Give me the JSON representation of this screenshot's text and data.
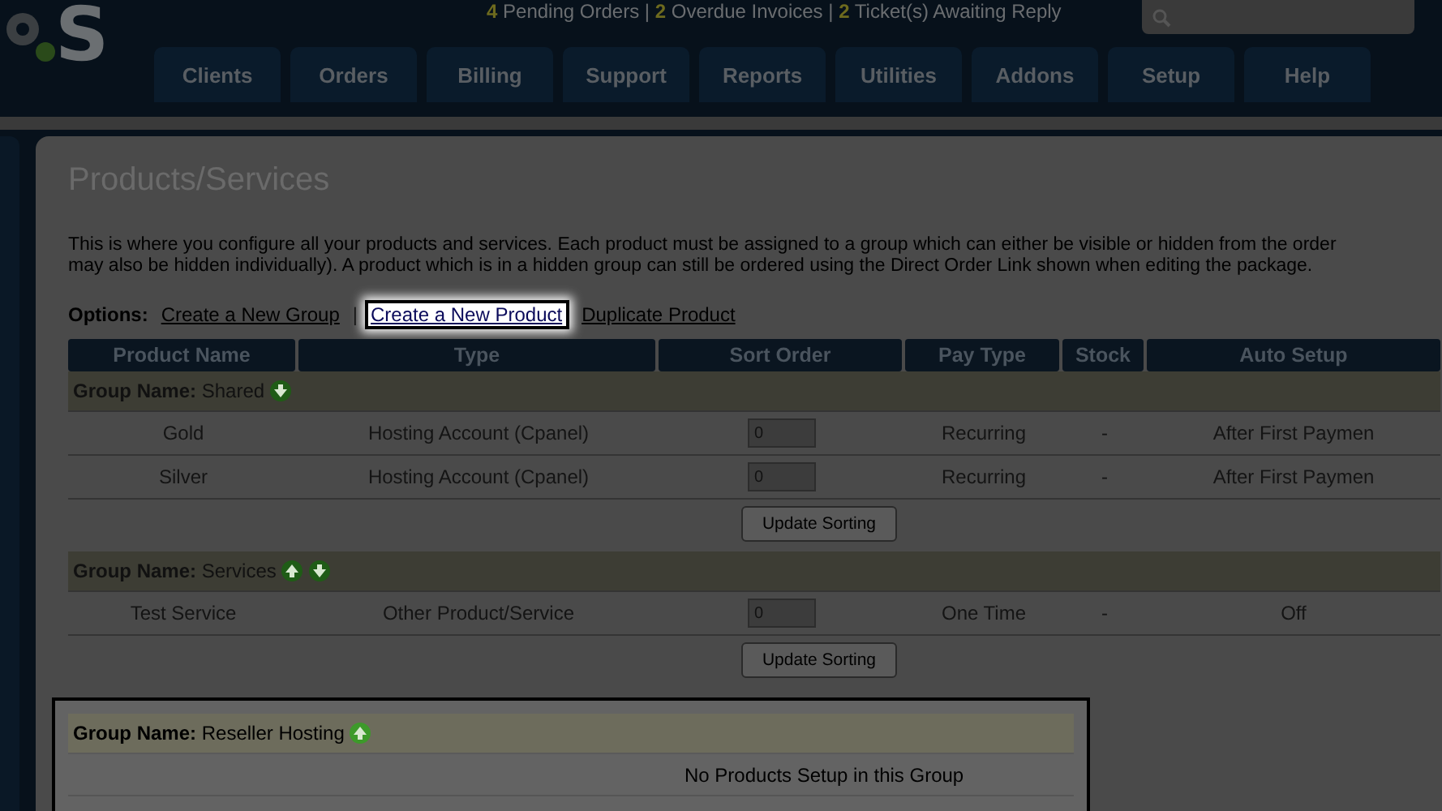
{
  "header": {
    "logo": {
      "text": "S"
    },
    "alerts": [
      {
        "count": "4",
        "label": "Pending Orders"
      },
      {
        "count": "2",
        "label": "Overdue Invoices"
      },
      {
        "count": "2",
        "label": "Ticket(s) Awaiting Reply"
      }
    ],
    "alert_separator": "|"
  },
  "nav": [
    "Clients",
    "Orders",
    "Billing",
    "Support",
    "Reports",
    "Utilities",
    "Addons",
    "Setup",
    "Help"
  ],
  "page": {
    "title": "Products/Services",
    "intro": [
      "This is where you configure all your products and services. Each product must be assigned to a group which can either be visible or hidden from the order",
      "may also be hidden individually). A product which is in a hidden group can still be ordered using the Direct Order Link shown when editing the package."
    ],
    "options": {
      "label": "Options:",
      "items": [
        {
          "kind": "link",
          "text": "Create a New Group",
          "highlighted": false
        },
        {
          "kind": "separator",
          "text": "|"
        },
        {
          "kind": "link",
          "text": "Create a New Product",
          "highlighted": true
        },
        {
          "kind": "link",
          "text": "Duplicate Product",
          "highlighted": false
        }
      ]
    }
  },
  "table": {
    "columns": [
      "Product Name",
      "Type",
      "Sort Order",
      "Pay Type",
      "Stock",
      "Auto Setup"
    ],
    "groups": [
      {
        "label": "Group Name:",
        "name": "Shared",
        "highlighted": false,
        "sort_buttons": [
          {
            "kind": "down"
          }
        ],
        "rows": [
          {
            "product": "Gold",
            "type": "Hosting Account (Cpanel)",
            "sort_order": "0",
            "pay_type": "Recurring",
            "stock": "-",
            "auto_setup": "After First Paymen"
          },
          {
            "product": "Silver",
            "type": "Hosting Account (Cpanel)",
            "sort_order": "0",
            "pay_type": "Recurring",
            "stock": "-",
            "auto_setup": "After First Paymen"
          }
        ],
        "button": "Update Sorting"
      },
      {
        "label": "Group Name:",
        "name": "Services",
        "highlighted": false,
        "sort_buttons": [
          {
            "kind": "up"
          },
          {
            "kind": "down"
          }
        ],
        "rows": [
          {
            "product": "Test Service",
            "type": "Other Product/Service",
            "sort_order": "0",
            "pay_type": "One Time",
            "stock": "-",
            "auto_setup": "Off"
          }
        ],
        "button": "Update Sorting"
      },
      {
        "label": "Group Name:",
        "name": "Reseller Hosting",
        "highlighted": true,
        "sort_buttons": [
          {
            "kind": "up"
          }
        ],
        "empty_message": "No Products Setup in this Group"
      }
    ]
  }
}
